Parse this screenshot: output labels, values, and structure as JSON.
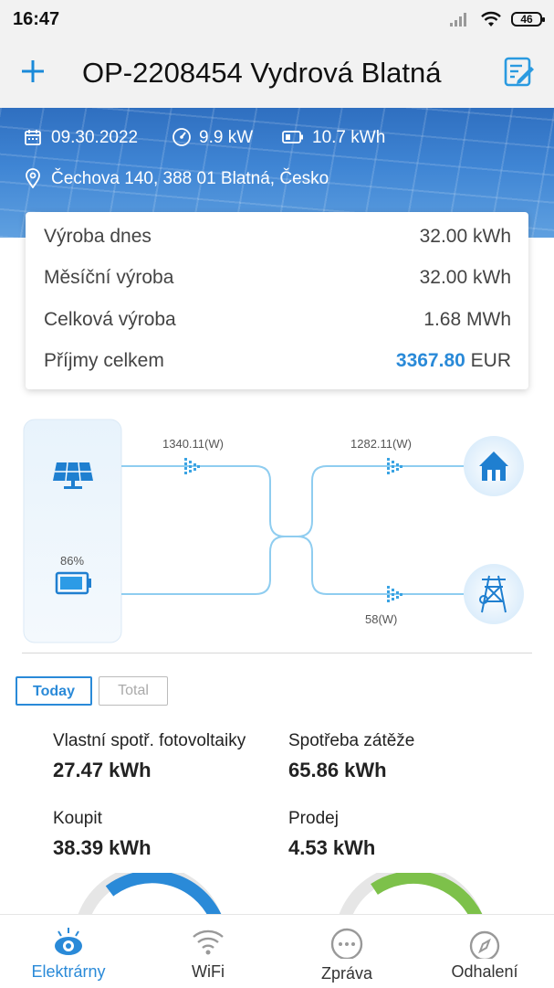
{
  "status_bar": {
    "time": "16:47",
    "battery": "46"
  },
  "header": {
    "title": "OP-2208454 Vydrová Blatná"
  },
  "banner": {
    "date": "09.30.2022",
    "power": "9.9 kW",
    "capacity": "10.7 kWh",
    "address": "Čechova 140, 388 01 Blatná, Česko"
  },
  "summary": {
    "rows": [
      {
        "label": "Výroba dnes",
        "value": "32.00 kWh"
      },
      {
        "label": "Měsíční výroba",
        "value": "32.00 kWh"
      },
      {
        "label": "Celková výroba",
        "value": "1.68 MWh"
      }
    ],
    "income": {
      "label": "Příjmy celkem",
      "amount": "3367.80",
      "currency": "EUR"
    }
  },
  "flow": {
    "pv_power": "1340.11(W)",
    "load_power": "1282.11(W)",
    "battery_soc": "86%",
    "grid_power": "58(W)"
  },
  "tabs": {
    "today": "Today",
    "total": "Total"
  },
  "metrics": [
    {
      "label": "Vlastní spotř. fotovoltaiky",
      "value": "27.47 kWh"
    },
    {
      "label": "Spotřeba zátěže",
      "value": "65.86 kWh"
    },
    {
      "label": "Koupit",
      "value": "38.39 kWh"
    },
    {
      "label": "Prodej",
      "value": "4.53 kWh"
    }
  ],
  "nav": {
    "plants": "Elektrárny",
    "wifi": "WiFi",
    "messages": "Zpráva",
    "discover": "Odhalení"
  },
  "colors": {
    "accent": "#2a8ad8",
    "flow_line": "#8fcdf0",
    "gauge_blue": "#2a8ad8",
    "gauge_green": "#7dc14a"
  }
}
